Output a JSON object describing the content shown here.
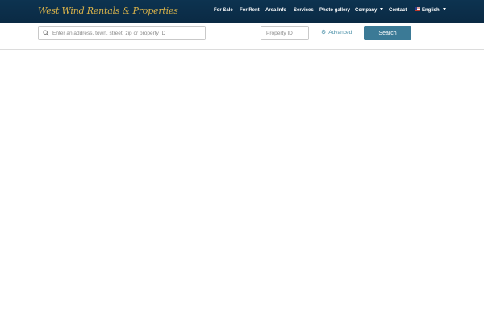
{
  "logo_text": "West Wind Rentals & Properties",
  "nav": {
    "for_sale": "For Sale",
    "for_rent": "For Rent",
    "area_info": "Area Info",
    "services": "Services",
    "photo_gallery": "Photo gallery",
    "company": "Company",
    "contact": "Contact",
    "language": "English"
  },
  "search": {
    "address_placeholder": "Enter an address, town, street, zip or property ID",
    "property_id_placeholder": "Property ID",
    "advanced_label": "Advanced",
    "search_button_label": "Search"
  },
  "colors": {
    "navbar_bg": "#0d3350",
    "logo_gold": "#d8b24a",
    "search_button_bg": "#3b7a96",
    "link_teal": "#4a90a8"
  },
  "icons": {
    "search": "search-icon",
    "gear": "gear-icon",
    "flag": "uk-flag-icon",
    "caret": "chevron-down-icon"
  }
}
